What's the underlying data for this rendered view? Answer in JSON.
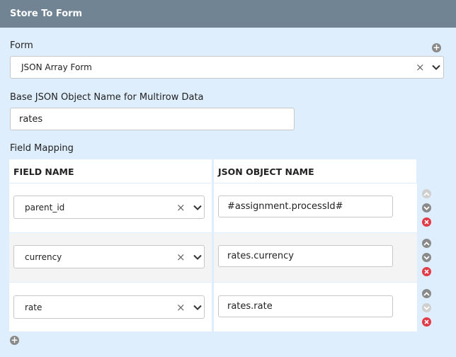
{
  "header": {
    "title": "Store To Form"
  },
  "form": {
    "label": "Form",
    "selected": "JSON Array Form"
  },
  "base_object": {
    "label": "Base JSON Object Name for Multirow Data",
    "value": "rates"
  },
  "mapping": {
    "label": "Field Mapping",
    "columns": [
      "FIELD NAME",
      "JSON OBJECT NAME"
    ],
    "rows": [
      {
        "field": "parent_id",
        "json": "#assignment.processId#"
      },
      {
        "field": "currency",
        "json": "rates.currency"
      },
      {
        "field": "rate",
        "json": "rates.rate"
      }
    ]
  },
  "icons": {
    "add": "plus-circle-icon",
    "clear": "x-icon",
    "dropdown": "chevron-down-icon",
    "move_up": "chevron-up-circle-icon",
    "move_down": "chevron-down-circle-icon",
    "delete": "x-circle-icon"
  },
  "colors": {
    "header_bg": "#708494",
    "page_bg": "#deeefc",
    "delete_red": "#e23b47",
    "icon_grey": "#8a8a8a",
    "icon_disabled": "#cfcfcf"
  }
}
